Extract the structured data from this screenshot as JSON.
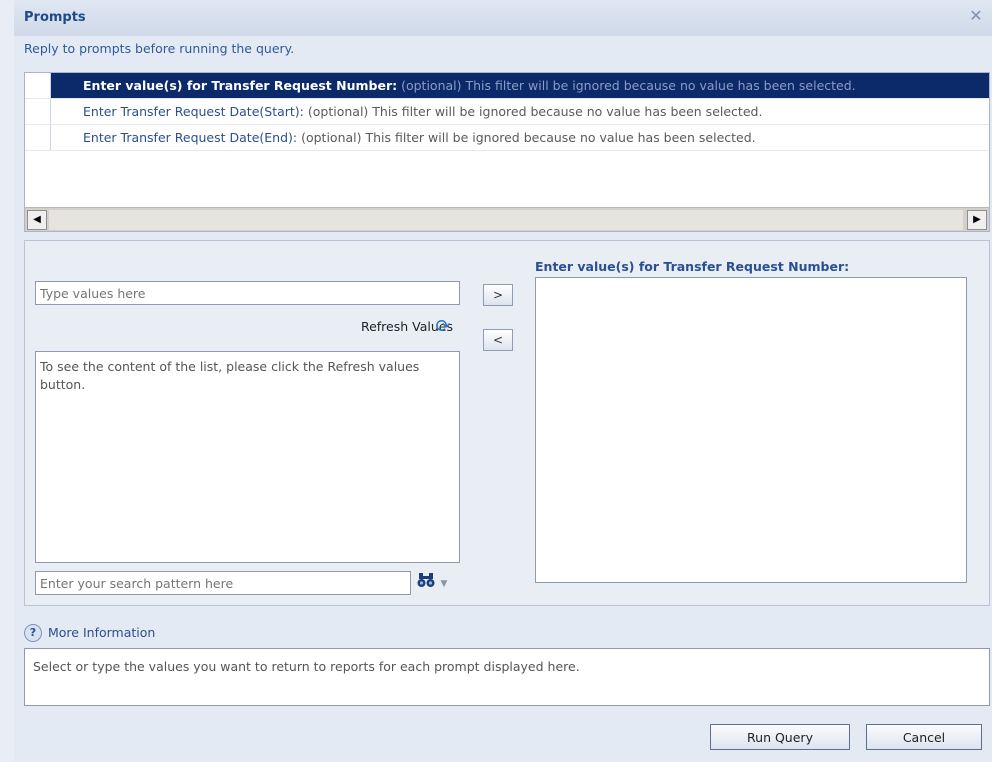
{
  "dialog": {
    "title": "Prompts",
    "close_glyph": "✕",
    "subtitle": "Reply to prompts before running the query."
  },
  "prompts": [
    {
      "name": "Enter value(s) for Transfer Request Number:",
      "description": "(optional) This filter will be ignored because no value has been selected.",
      "selected": true
    },
    {
      "name": "Enter Transfer Request Date(Start):",
      "description": "(optional) This filter will be ignored because no value has been selected.",
      "selected": false
    },
    {
      "name": "Enter Transfer Request Date(End):",
      "description": "(optional) This filter will be ignored because no value has been selected.",
      "selected": false
    }
  ],
  "scrollbar": {
    "left_glyph": "◀",
    "right_glyph": "▶"
  },
  "value_panel": {
    "type_placeholder": "Type values here",
    "refresh_label": "Refresh Values",
    "refresh_icon": "refresh-icon",
    "list_message": "To see the content of the list, please click the Refresh values button.",
    "search_placeholder": "Enter your search pattern here",
    "search_icon": "binoculars-icon",
    "add_glyph": ">",
    "remove_glyph": "<",
    "selected_label": "Enter value(s) for Transfer Request Number:"
  },
  "footer": {
    "more_info_label": "More Information",
    "help_glyph": "?",
    "info_text": "Select or type the values you want to return to reports for each prompt displayed here.",
    "run_label": "Run Query",
    "cancel_label": "Cancel"
  },
  "colors": {
    "selected_row": "#0c2a6a",
    "link_blue": "#2b4f93"
  }
}
